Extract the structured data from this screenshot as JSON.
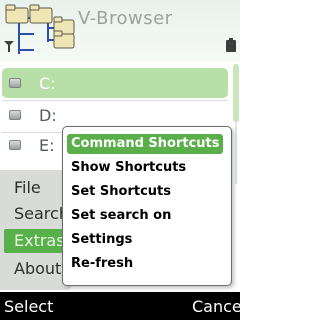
{
  "header": {
    "title": "V-Browser",
    "logo_icon": "folder-tree-icon",
    "signal_icon": "signal-icon",
    "battery_icon": "battery-icon"
  },
  "drives": [
    {
      "label": "C:",
      "selected": true,
      "icon": "drive-icon"
    },
    {
      "label": "D:",
      "selected": false,
      "icon": "drive-icon"
    },
    {
      "label": "E:",
      "selected": false,
      "icon": "drive-icon"
    }
  ],
  "main_menu": {
    "items": [
      {
        "label": "File"
      },
      {
        "label": "Search"
      },
      {
        "label": "Extras"
      },
      {
        "label": "About"
      }
    ],
    "selected": "Extras"
  },
  "submenu": {
    "items": [
      {
        "label": "Command Shortcuts"
      },
      {
        "label": "Show Shortcuts"
      },
      {
        "label": "Set Shortcuts"
      },
      {
        "label": "Set search on"
      },
      {
        "label": "Settings"
      },
      {
        "label": "Re-fresh"
      }
    ],
    "selected": "Command Shortcuts"
  },
  "softkeys": {
    "left": "Select",
    "right": "Cancel"
  },
  "colors": {
    "selection_green": "#5aaf4a",
    "list_highlight": "#b8dfa7",
    "softkey_bar": "#000000"
  }
}
